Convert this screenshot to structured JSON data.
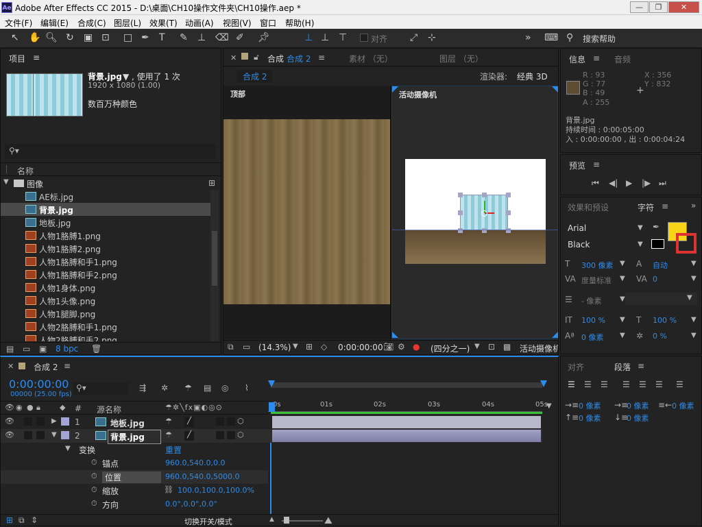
{
  "app": {
    "title": "Adobe After Effects CC 2015 - D:\\桌面\\CH10操作文件夹\\CH10操作.aep *",
    "logo": "Ae"
  },
  "window_buttons": [
    "—",
    "❐",
    "✕"
  ],
  "menu": [
    "文件(F)",
    "编辑(E)",
    "合成(C)",
    "图层(L)",
    "效果(T)",
    "动画(A)",
    "视图(V)",
    "窗口",
    "帮助(H)"
  ],
  "toolbar": {
    "align_label": "对齐",
    "search_label": "搜索帮助"
  },
  "project": {
    "title": "项目",
    "file_name": "背景.jpg",
    "file_info": "▼ , 使用了 1 次",
    "dims": "1920 x 1080 (1.00)",
    "colors": "数百万种颜色",
    "col_name": "名称",
    "folder": "图像",
    "items": [
      {
        "name": "AE标.jpg",
        "type": "jpg"
      },
      {
        "name": "背景.jpg",
        "type": "jpg",
        "selected": true
      },
      {
        "name": "地板.jpg",
        "type": "jpg"
      },
      {
        "name": "人物1胳膊1.png",
        "type": "png"
      },
      {
        "name": "人物1胳膊2.png",
        "type": "png"
      },
      {
        "name": "人物1胳膊和手1.png",
        "type": "png"
      },
      {
        "name": "人物1胳膊和手2.png",
        "type": "png"
      },
      {
        "name": "人物1身体.png",
        "type": "png"
      },
      {
        "name": "人物1头像.png",
        "type": "png"
      },
      {
        "name": "人物1腿脚.png",
        "type": "png"
      },
      {
        "name": "人物2胳膊和手1.png",
        "type": "png"
      },
      {
        "name": "人物2胳膊和手2.png",
        "type": "png"
      }
    ],
    "bpc": "8 bpc"
  },
  "comp_viewer": {
    "tab_prefix": "合成",
    "tab_name": "合成 2",
    "material": "素材 （无）",
    "layer": "图层 （无）",
    "subtab": "合成 2",
    "renderer_label": "渲染器:",
    "renderer_value": "经典 3D",
    "view_top": "顶部",
    "view_camera": "活动摄像机",
    "zoom": "(14.3%)",
    "timecode": "0:00:00:00",
    "quality": "(四分之一)",
    "camera_dd": "活动摄像机"
  },
  "info": {
    "tab1": "信息",
    "tab2": "音频",
    "r": "R : 93",
    "g": "G : 77",
    "b": "B : 49",
    "a": "A : 255",
    "x": "X : 356",
    "y": "Y : 832",
    "swatch": "#5d4d31",
    "name": "背景.jpg",
    "duration": "持续时间 : 0:00:05:00",
    "inout": "入 : 0:00:00:00 , 出 : 0:00:04:24"
  },
  "preview": {
    "title": "预览"
  },
  "character": {
    "tab1": "效果和预设",
    "tab2": "字符",
    "font": "Arial",
    "style": "Black",
    "size": "300 像素",
    "leading": "自动",
    "kerning": "度量标准",
    "tracking": "0",
    "stroke": "- 像素",
    "vscale": "100 %",
    "hscale": "100 %",
    "baseline": "0 像素",
    "tsume": "0 %",
    "fill": "#f7d417"
  },
  "paragraph": {
    "tab1": "对齐",
    "tab2": "段落",
    "indent_left": "0 像素",
    "indent_first": "0 像素",
    "indent_right": "0 像素",
    "space_before": "0 像素",
    "space_after": "0 像素"
  },
  "timeline": {
    "comp_name": "合成 2",
    "timecode": "0:00:00:00",
    "frames": "00000 (25.00 fps)",
    "col_src": "源名称",
    "col_num": "#",
    "ruler": [
      "0s",
      "01s",
      "02s",
      "03s",
      "04s",
      "05s"
    ],
    "layers": [
      {
        "num": "1",
        "name": "地板.jpg"
      },
      {
        "num": "2",
        "name": "背景.jpg"
      }
    ],
    "transform": "变换",
    "reset": "重置",
    "props": [
      {
        "name": "锚点",
        "value": "960.0,540.0,0.0"
      },
      {
        "name": "位置",
        "value": "960.0,540.0,5000.0"
      },
      {
        "name": "缩放",
        "value": "100.0,100.0,100.0%"
      },
      {
        "name": "方向",
        "value": "0.0°,0.0°,0.0°"
      }
    ],
    "footer": "切换开关/模式"
  }
}
